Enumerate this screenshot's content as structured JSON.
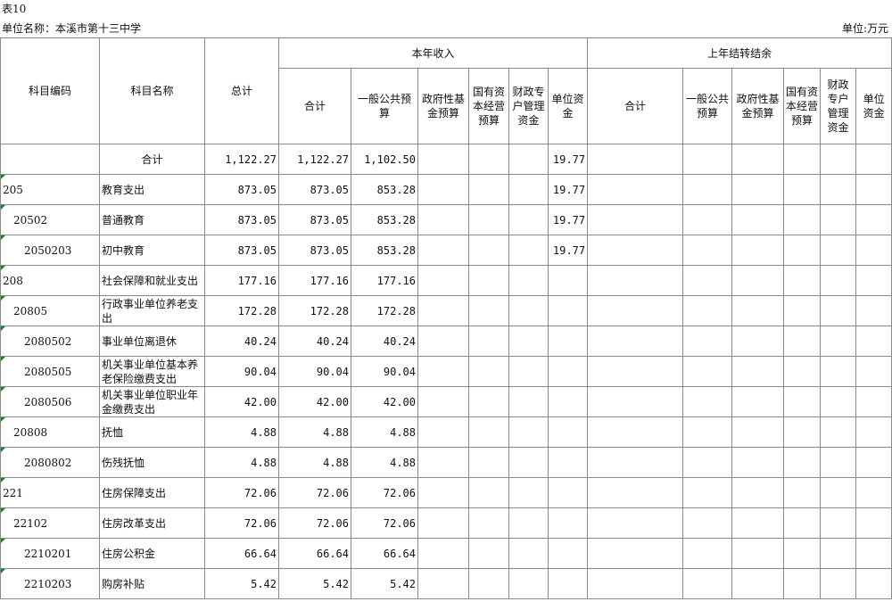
{
  "header": {
    "table_label": "表10",
    "unit_name": "单位名称：本溪市第十三中学",
    "unit_money": "单位:万元"
  },
  "columns": {
    "code": "科目编码",
    "name": "科目名称",
    "total": "总计",
    "current_year_group": "本年收入",
    "prior_year_group": "上年结转结余",
    "sub": {
      "sum": "合计",
      "general": "一般公共预算",
      "fund": "政府性基金预算",
      "state": "国有资本经营预算",
      "special": "财政专户管理资金",
      "unit": "单位资金"
    },
    "prior_sub": {
      "sum": "合计",
      "general": "一般公共预算",
      "fund": "政府性基金预算",
      "state": "国有资本经营预算",
      "special": "财政专户管理资金",
      "unit": "单位资金"
    }
  },
  "rows": [
    {
      "code": "",
      "level": 0,
      "name": "合计",
      "total": "1,122.27",
      "sum": "1,122.27",
      "general": "1,102.50",
      "unit": "19.77"
    },
    {
      "code": "205",
      "level": 1,
      "name": "教育支出",
      "total": "873.05",
      "sum": "873.05",
      "general": "853.28",
      "unit": "19.77"
    },
    {
      "code": "20502",
      "level": 2,
      "name": "普通教育",
      "total": "873.05",
      "sum": "873.05",
      "general": "853.28",
      "unit": "19.77"
    },
    {
      "code": "2050203",
      "level": 3,
      "name": "初中教育",
      "total": "873.05",
      "sum": "873.05",
      "general": "853.28",
      "unit": "19.77"
    },
    {
      "code": "208",
      "level": 1,
      "name": "社会保障和就业支出",
      "total": "177.16",
      "sum": "177.16",
      "general": "177.16",
      "unit": ""
    },
    {
      "code": "20805",
      "level": 2,
      "name": "行政事业单位养老支出",
      "total": "172.28",
      "sum": "172.28",
      "general": "172.28",
      "unit": ""
    },
    {
      "code": "2080502",
      "level": 3,
      "name": "事业单位离退休",
      "total": "40.24",
      "sum": "40.24",
      "general": "40.24",
      "unit": ""
    },
    {
      "code": "2080505",
      "level": 3,
      "name": "机关事业单位基本养老保险缴费支出",
      "total": "90.04",
      "sum": "90.04",
      "general": "90.04",
      "unit": ""
    },
    {
      "code": "2080506",
      "level": 3,
      "name": "机关事业单位职业年金缴费支出",
      "total": "42.00",
      "sum": "42.00",
      "general": "42.00",
      "unit": ""
    },
    {
      "code": "20808",
      "level": 2,
      "name": "抚恤",
      "total": "4.88",
      "sum": "4.88",
      "general": "4.88",
      "unit": ""
    },
    {
      "code": "2080802",
      "level": 3,
      "name": "伤残抚恤",
      "total": "4.88",
      "sum": "4.88",
      "general": "4.88",
      "unit": ""
    },
    {
      "code": "221",
      "level": 1,
      "name": "住房保障支出",
      "total": "72.06",
      "sum": "72.06",
      "general": "72.06",
      "unit": ""
    },
    {
      "code": "22102",
      "level": 2,
      "name": "住房改革支出",
      "total": "72.06",
      "sum": "72.06",
      "general": "72.06",
      "unit": ""
    },
    {
      "code": "2210201",
      "level": 3,
      "name": "住房公积金",
      "total": "66.64",
      "sum": "66.64",
      "general": "66.64",
      "unit": ""
    },
    {
      "code": "2210203",
      "level": 3,
      "name": "购房补贴",
      "total": "5.42",
      "sum": "5.42",
      "general": "5.42",
      "unit": ""
    }
  ]
}
